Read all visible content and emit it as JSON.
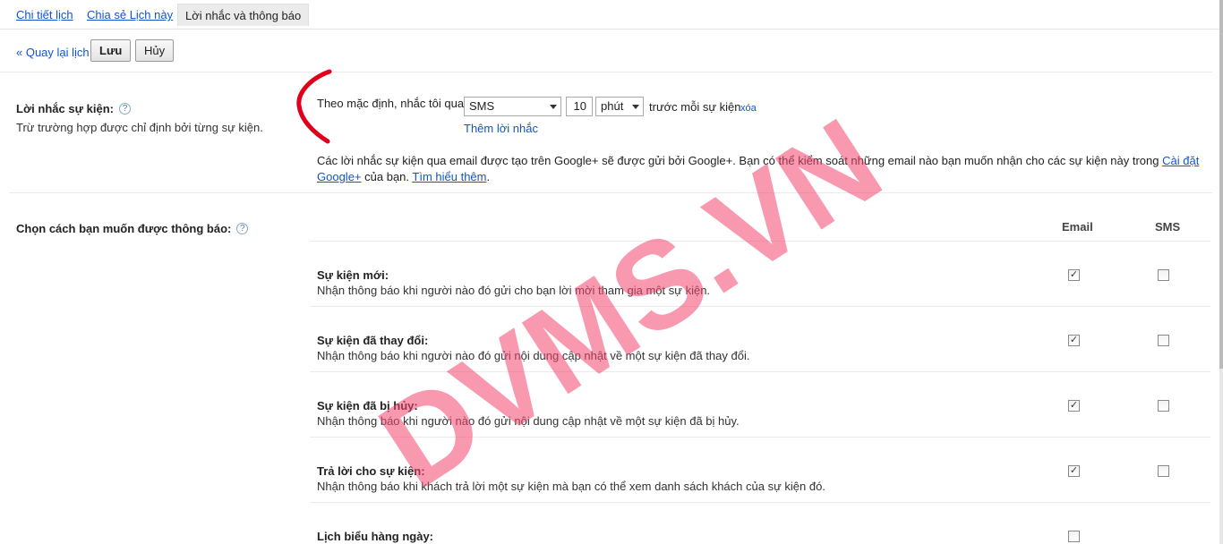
{
  "tabs": [
    {
      "label": "Chi tiết lịch"
    },
    {
      "label": "Chia sẻ Lịch này"
    },
    {
      "label": "Lời nhắc và thông báo"
    }
  ],
  "toolbar": {
    "back_label": "« Quay lại lịch",
    "save_label": "Lưu",
    "cancel_label": "Hủy"
  },
  "reminders": {
    "label": "Lời nhắc sự kiện:",
    "help_icon": "?",
    "sublabel": "Trừ trường hợp được chỉ định bởi từng sự kiện.",
    "default_text": "Theo mặc định, nhắc tôi qua",
    "method_value": "SMS",
    "amount_value": "10",
    "unit_value": "phút",
    "after_text": "trước mỗi sự kiện",
    "remove_label": "xóa",
    "add_label": "Thêm lời nhắc",
    "gplus_note": "Các lời nhắc sự kiện qua email được tạo trên Google+ sẽ được gửi bởi Google+. Bạn có thể kiểm soát những email nào bạn muốn nhận cho các sự kiện này trong",
    "gplus_link": "Cài đặt Google+",
    "gplus_note_end": "của bạn.",
    "learn_more": "Tìm hiểu thêm"
  },
  "notifications": {
    "label": "Chọn cách bạn muốn được thông báo:",
    "help_icon": "?",
    "col_email": "Email",
    "col_sms": "SMS",
    "rows": [
      {
        "title": "Sự kiện mới:",
        "desc": "Nhận thông báo khi người nào đó gửi cho bạn lời mời tham gia một sự kiện.",
        "email": true,
        "sms": false
      },
      {
        "title": "Sự kiện đã thay đổi:",
        "desc": "Nhận thông báo khi người nào đó gửi nội dung cập nhật về một sự kiện đã thay đổi.",
        "email": true,
        "sms": false
      },
      {
        "title": "Sự kiện đã bị hủy:",
        "desc": "Nhận thông báo khi người nào đó gửi nội dung cập nhật về một sự kiện đã bị hủy.",
        "email": true,
        "sms": false
      },
      {
        "title": "Trả lời cho sự kiện:",
        "desc": "Nhận thông báo khi khách trả lời một sự kiện mà bạn có thể xem danh sách khách của sự kiện đó.",
        "email": true,
        "sms": false
      },
      {
        "title": "Lịch biểu hàng ngày:",
        "desc": "",
        "email": false,
        "sms": null
      }
    ]
  },
  "watermark": "DVMS.VN",
  "colors": {
    "link": "#1155cc",
    "watermark": "#f4466e",
    "bracket": "#e0001b"
  }
}
